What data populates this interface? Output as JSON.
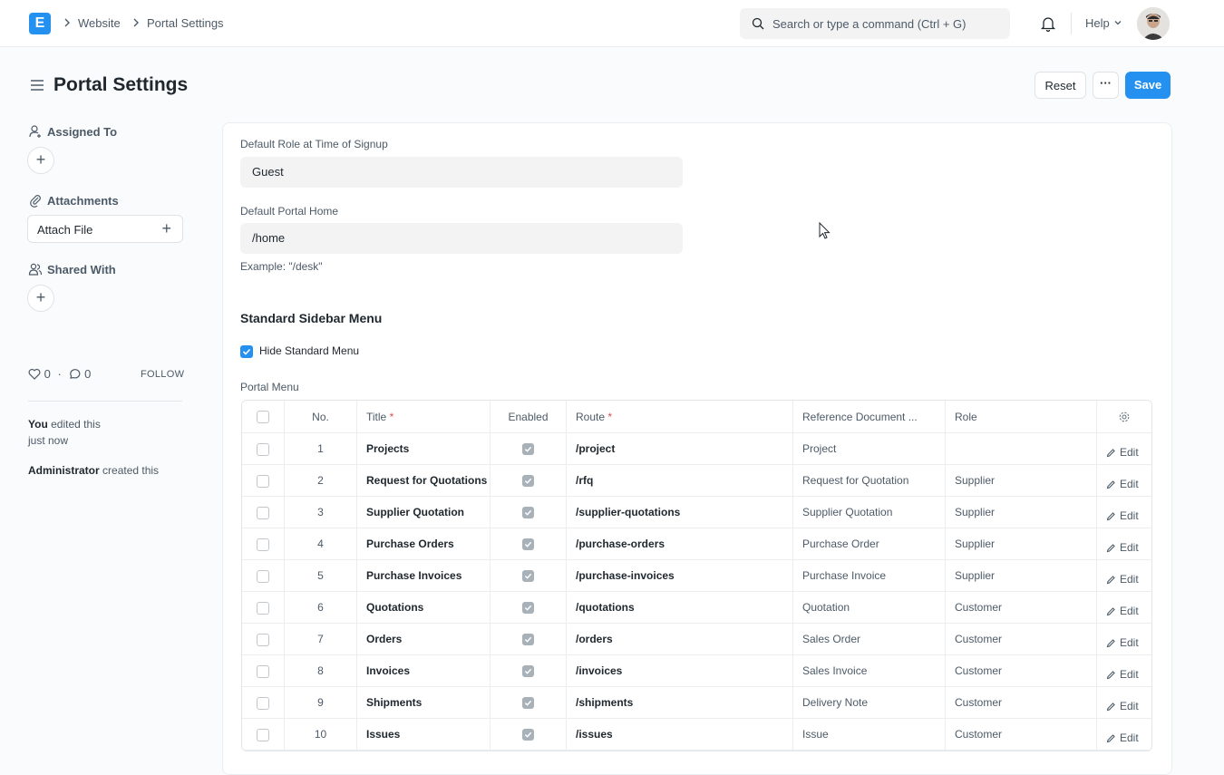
{
  "navbar": {
    "logo_letter": "E",
    "breadcrumbs": [
      "Website",
      "Portal Settings"
    ],
    "search_placeholder": "Search or type a command (Ctrl + G)",
    "help_label": "Help"
  },
  "page": {
    "title": "Portal Settings",
    "reset_label": "Reset",
    "more_label": "···",
    "save_label": "Save"
  },
  "sidebar": {
    "assigned_to": "Assigned To",
    "attachments": "Attachments",
    "attach_file": "Attach File",
    "shared_with": "Shared With",
    "likes": "0",
    "comments": "0",
    "follow": "FOLLOW",
    "timeline": [
      {
        "actor": "You",
        "text": " edited this",
        "time": "just now"
      },
      {
        "actor": "Administrator",
        "text": " created this"
      }
    ]
  },
  "form": {
    "default_role_label": "Default Role at Time of Signup",
    "default_role_value": "Guest",
    "default_home_label": "Default Portal Home",
    "default_home_value": "/home",
    "default_home_hint": "Example: \"/desk\"",
    "section_title": "Standard Sidebar Menu",
    "hide_standard_menu_label": "Hide Standard Menu",
    "portal_menu_label": "Portal Menu"
  },
  "table": {
    "headers": {
      "no": "No.",
      "title": "Title",
      "enabled": "Enabled",
      "route": "Route",
      "reference": "Reference Document ...",
      "role": "Role"
    },
    "edit_label": "Edit",
    "rows": [
      {
        "no": "1",
        "title": "Projects",
        "route": "/project",
        "reference": "Project",
        "role": ""
      },
      {
        "no": "2",
        "title": "Request for Quotations",
        "route": "/rfq",
        "reference": "Request for Quotation",
        "role": "Supplier"
      },
      {
        "no": "3",
        "title": "Supplier Quotation",
        "route": "/supplier-quotations",
        "reference": "Supplier Quotation",
        "role": "Supplier"
      },
      {
        "no": "4",
        "title": "Purchase Orders",
        "route": "/purchase-orders",
        "reference": "Purchase Order",
        "role": "Supplier"
      },
      {
        "no": "5",
        "title": "Purchase Invoices",
        "route": "/purchase-invoices",
        "reference": "Purchase Invoice",
        "role": "Supplier"
      },
      {
        "no": "6",
        "title": "Quotations",
        "route": "/quotations",
        "reference": "Quotation",
        "role": "Customer"
      },
      {
        "no": "7",
        "title": "Orders",
        "route": "/orders",
        "reference": "Sales Order",
        "role": "Customer"
      },
      {
        "no": "8",
        "title": "Invoices",
        "route": "/invoices",
        "reference": "Sales Invoice",
        "role": "Customer"
      },
      {
        "no": "9",
        "title": "Shipments",
        "route": "/shipments",
        "reference": "Delivery Note",
        "role": "Customer"
      },
      {
        "no": "10",
        "title": "Issues",
        "route": "/issues",
        "reference": "Issue",
        "role": "Customer"
      }
    ]
  }
}
